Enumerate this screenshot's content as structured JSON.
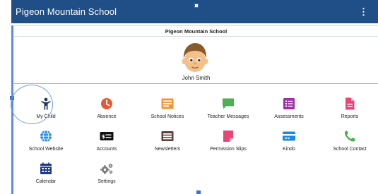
{
  "appbar": {
    "title": "Pigeon Mountain School",
    "menu_glyph": "⋮"
  },
  "header": {
    "school_name": "Pigeon Mountain School"
  },
  "profile": {
    "name": "John Smith"
  },
  "tiles": [
    {
      "label": "My Child",
      "icon": "child-icon",
      "color": "#1f3a5f"
    },
    {
      "label": "Absence",
      "icon": "clock-icon",
      "color": "#e25b34"
    },
    {
      "label": "School Notices",
      "icon": "notice-board-icon",
      "color": "#f0953a"
    },
    {
      "label": "Teacher Messages",
      "icon": "chat-bubble-icon",
      "color": "#4caf50"
    },
    {
      "label": "Assessments",
      "icon": "checklist-icon",
      "color": "#9c2fa3"
    },
    {
      "label": "Reports",
      "icon": "document-icon",
      "color": "#e84677"
    },
    {
      "label": "School Website",
      "icon": "globe-icon",
      "color": "#1e88e5"
    },
    {
      "label": "Accounts",
      "icon": "dollar-card-icon",
      "color": "#111111"
    },
    {
      "label": "Newsletters",
      "icon": "newspaper-icon",
      "color": "#5d4037"
    },
    {
      "label": "Permission Slips",
      "icon": "signed-slip-icon",
      "color": "#e84677"
    },
    {
      "label": "Kindo",
      "icon": "card-icon",
      "color": "#1e88e5"
    },
    {
      "label": "School Contact",
      "icon": "phone-icon",
      "color": "#4caf50"
    },
    {
      "label": "Calendar",
      "icon": "calendar-icon",
      "color": "#1f3a8a"
    },
    {
      "label": "Settings",
      "icon": "gears-icon",
      "color": "#777777"
    }
  ],
  "colors": {
    "appbar": "#1f4f86",
    "divider": "#efa64a"
  }
}
